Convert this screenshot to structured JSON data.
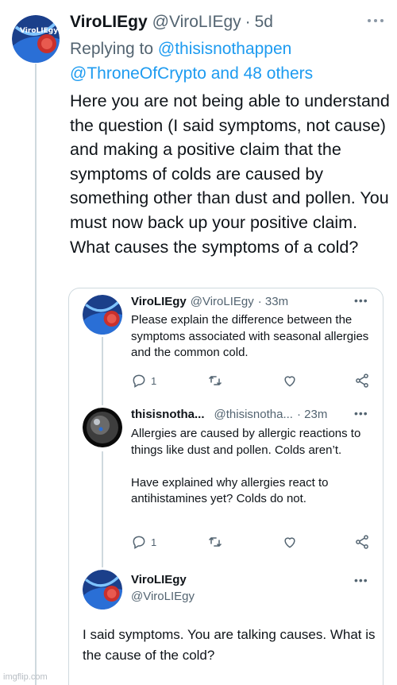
{
  "main_tweet": {
    "author_name": "ViroLIEgy",
    "handle": "@ViroLIEgy",
    "separator": "·",
    "time": "5d",
    "replying_prefix": "Replying to ",
    "replying_to_1": "@thisisnothappen",
    "replying_to_2": "@ThroneOfCrypto",
    "replying_suffix": " and 48 others",
    "body": "Here you are not being able to understand the question (I said symptoms, not cause) and making a positive claim that the symptoms of colds are caused by something other than dust and pollen. You must now back up your positive claim. What causes the symptoms of a cold?",
    "more_icon": "more-horizontal-icon"
  },
  "quote_1": {
    "author_name": "ViroLIEgy",
    "handle": "@ViroLIEgy",
    "time": "· 33m",
    "body": "Please explain the difference between the symptoms associated with seasonal allergies and the common cold.",
    "reply_count": "1"
  },
  "quote_2": {
    "author_name": "thisisnotha...",
    "handle": "@thisisnotha...",
    "time": "· 23m",
    "body": "Allergies are caused by allergic reactions to things like dust and pollen. Colds aren’t.\n\nHave explained why allergies react to antihistamines yet? Colds do not.",
    "reply_count": "1"
  },
  "quote_3": {
    "author_name": "ViroLIEgy",
    "handle": "@ViroLIEgy",
    "body": "I said symptoms. You are talking causes. What is the cause of the cold?"
  },
  "watermark": "imgflip.com",
  "colors": {
    "link": "#1d9bf0",
    "secondary_text": "#536471",
    "border": "#cfd9de"
  }
}
